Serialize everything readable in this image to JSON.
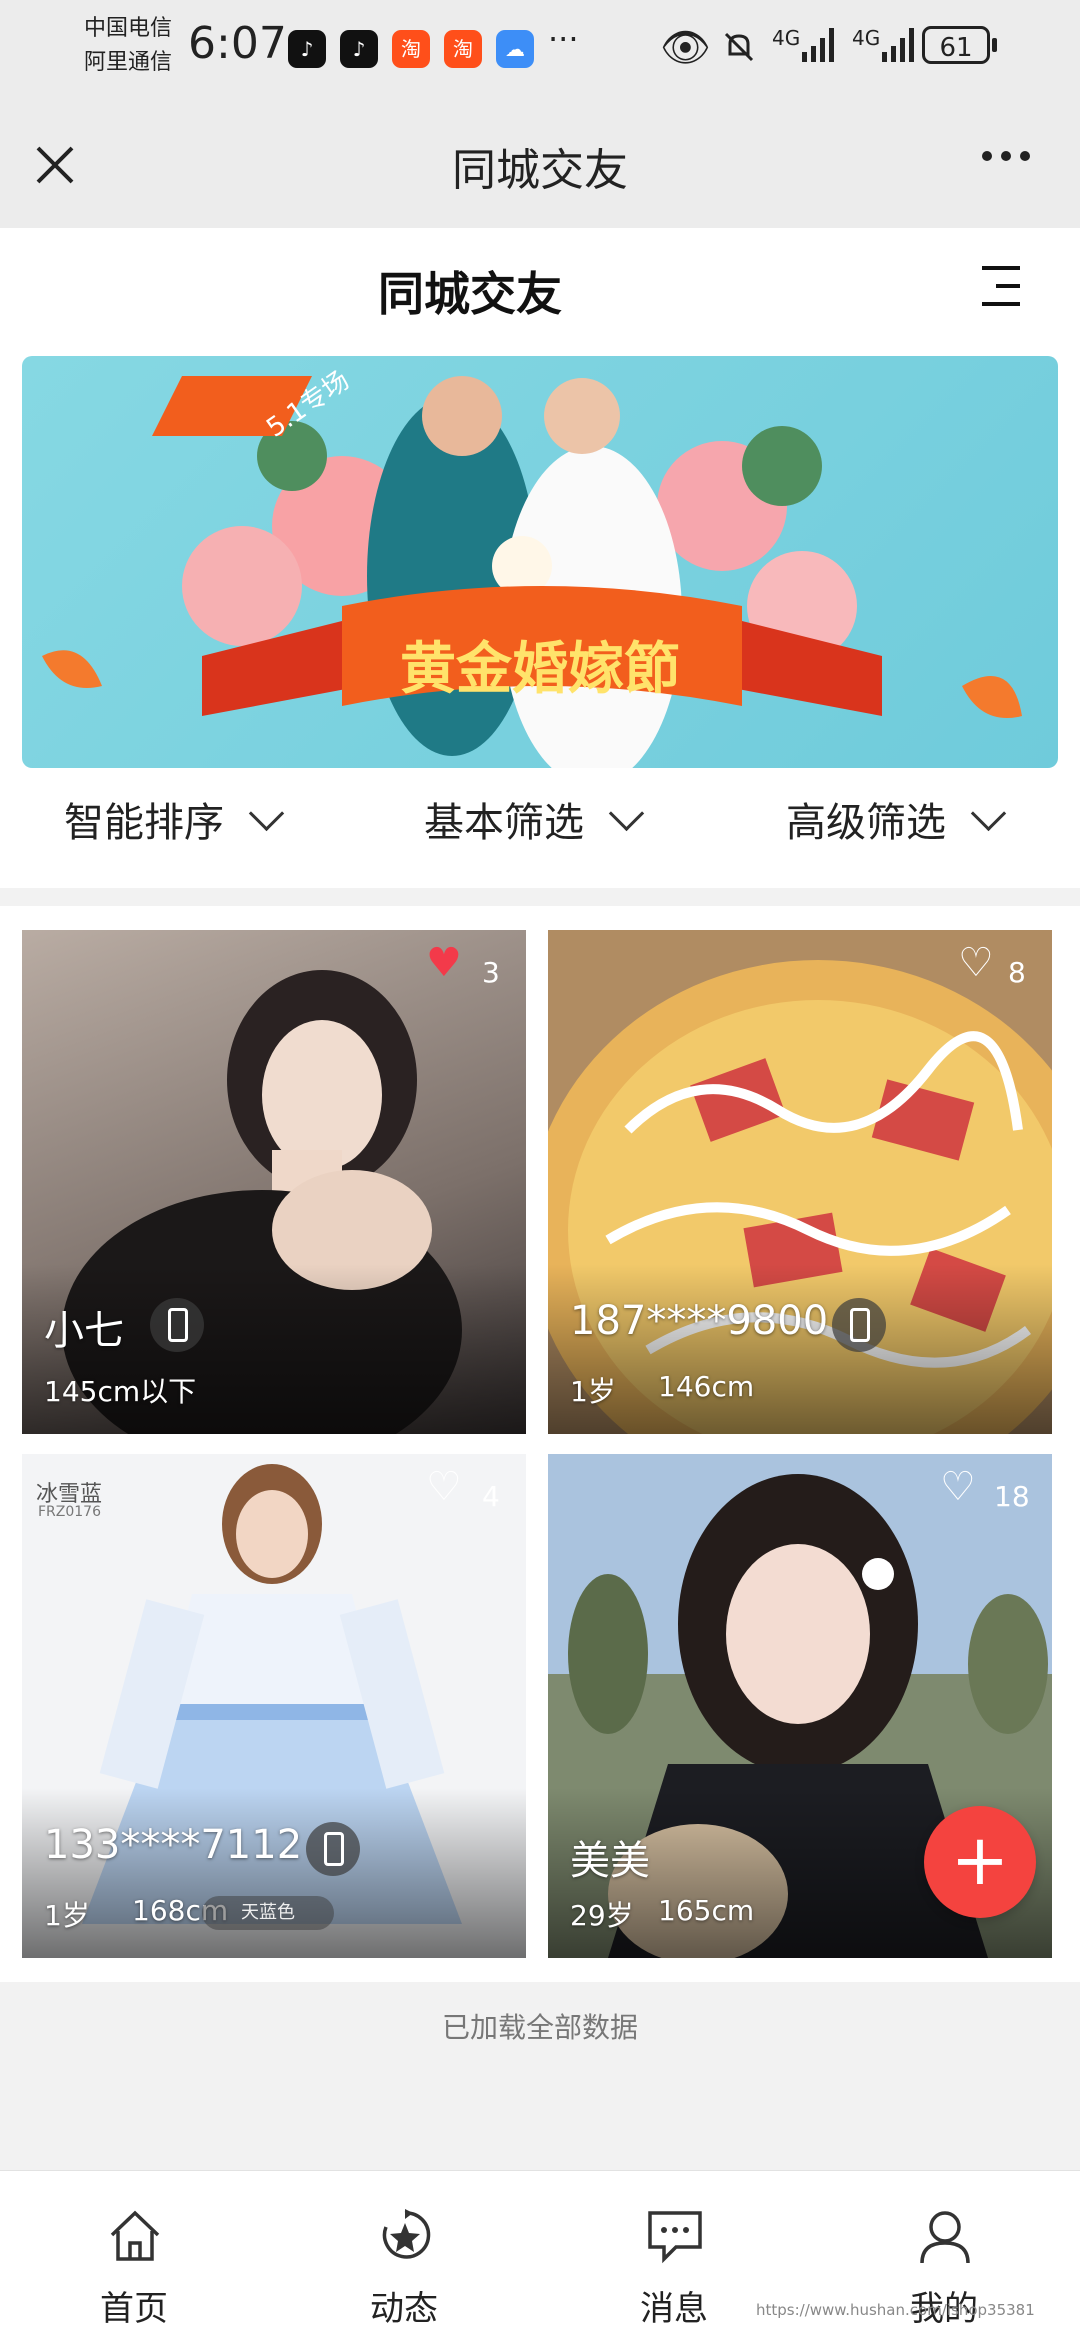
{
  "status_bar": {
    "carrier_1": "中国电信",
    "carrier_2": "阿里通信",
    "time": "6:07",
    "signal_1": "4G",
    "signal_2": "4G",
    "battery": "61",
    "more": "···"
  },
  "title_bar": {
    "title": "同城交友",
    "more": "···"
  },
  "page": {
    "heading": "同城交友"
  },
  "banner": {
    "title": "黄金婚嫁節",
    "badge": "5.1专场"
  },
  "filters": [
    {
      "label": "智能排序"
    },
    {
      "label": "基本筛选"
    },
    {
      "label": "高级筛选"
    }
  ],
  "cards": [
    {
      "name": "小七",
      "info1": "145cm以下",
      "info2": "",
      "likes": "3",
      "liked": true
    },
    {
      "name": "187****9800",
      "info1": "1岁",
      "info2": "146cm",
      "likes": "8",
      "liked": false
    },
    {
      "name": "133****7112",
      "info1": "1岁",
      "info2": "168cm",
      "likes": "4",
      "liked": false,
      "tag_top": "冰雪蓝",
      "tag_code": "FRZ0176",
      "tag_color": "天蓝色"
    },
    {
      "name": "美美",
      "info1": "29岁",
      "info2": "165cm",
      "likes": "18",
      "liked": false
    }
  ],
  "footer_text": "已加载全部数据",
  "fab_symbol": "+",
  "nav": [
    {
      "label": "首页",
      "icon": "home-icon"
    },
    {
      "label": "动态",
      "icon": "star-refresh-icon"
    },
    {
      "label": "消息",
      "icon": "message-icon"
    },
    {
      "label": "我的",
      "icon": "person-icon"
    }
  ],
  "watermark": "https://www.hushan.com/ishop35381",
  "colors": {
    "accent_red": "#f4433f",
    "heart_red": "#f33a4a",
    "banner_bg": "#7fd3e0"
  }
}
